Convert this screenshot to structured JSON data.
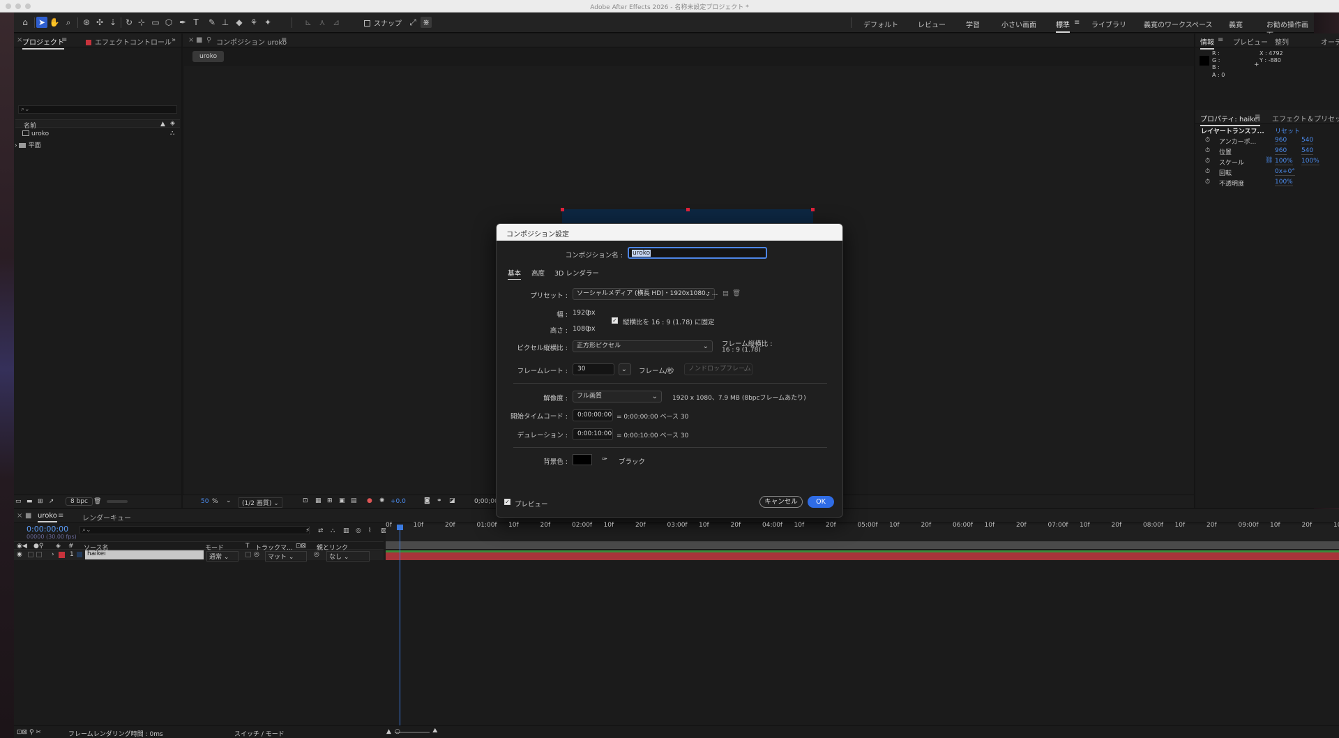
{
  "window": {
    "title": "Adobe After Effects 2026 - 名称未設定プロジェクト *"
  },
  "toolbar": {
    "snap_label": "スナップ"
  },
  "workspaces": [
    "デフォルト",
    "レビュー",
    "学習",
    "小さい画面",
    "標準",
    "ライブラリ",
    "義寛のワークスペース",
    "義寛",
    "お勧め操作画面"
  ],
  "project_panel": {
    "tab_project": "プロジェクト",
    "tab_effects": "エフェクトコントロール",
    "search_placeholder": "",
    "col_name": "名前",
    "items": [
      "uroko",
      "平面"
    ],
    "bpc": "8 bpc"
  },
  "comp_panel": {
    "tab": "コンポジション uroko",
    "breadcrumb": "uroko",
    "zoom_value": "50",
    "zoom_unit": "%",
    "resolution": "(1/2 画質)",
    "exposure": "+0.0",
    "timecode": "0;00;00;"
  },
  "info_panel": {
    "tabs": [
      "情報",
      "プレビュー",
      "整列",
      "オーデ"
    ],
    "r": "R :",
    "g": "G :",
    "b": "B :",
    "a": "A : 0",
    "x": "X : 4792",
    "y": "Y : -880"
  },
  "properties_panel": {
    "tabs": [
      "プロパティ: haikei",
      "エフェクト＆プリセット"
    ],
    "section": "レイヤートランスフ...",
    "reset": "リセット",
    "rows": [
      {
        "label": "アンカーポ...",
        "v1": "960",
        "v2": "540"
      },
      {
        "label": "位置",
        "v1": "960",
        "v2": "540"
      },
      {
        "label": "スケール",
        "v1": "100%",
        "v2": "100%"
      },
      {
        "label": "回転",
        "v1": "0x+0°",
        "v2": ""
      },
      {
        "label": "不透明度",
        "v1": "100%",
        "v2": ""
      }
    ]
  },
  "dialog": {
    "title": "コンポジション設定",
    "name_label": "コンポジション名 :",
    "name_value": "uroko",
    "tabs": [
      "基本",
      "高度",
      "3D レンダラー"
    ],
    "preset_label": "プリセット :",
    "preset_value": "ソーシャルメディア (横長 HD)・1920x1080・...",
    "width_label": "幅 :",
    "width_value": "1920",
    "px": "px",
    "height_label": "高さ :",
    "height_value": "1080",
    "lock_label": "縦横比を 16 : 9 (1.78) に固定",
    "par_label": "ピクセル縦横比 :",
    "par_value": "正方形ピクセル",
    "frame_aspect_label": "フレーム縦横比 :",
    "frame_aspect_value": "16 : 9 (1.78)",
    "fps_label": "フレームレート :",
    "fps_value": "30",
    "fps_unit": "フレーム/秒",
    "dropframe": "ノンドロップフレーム",
    "res_label": "解像度 :",
    "res_value": "フル画質",
    "res_info": "1920 x 1080、7.9 MB (8bpcフレームあたり)",
    "start_label": "開始タイムコード :",
    "start_value": "0:00:00:00",
    "start_info": "= 0:00:00:00  ベース 30",
    "dur_label": "デュレーション :",
    "dur_value": "0:00:10:00",
    "dur_info": "= 0:00:10:00  ベース 30",
    "bg_label": "背景色 :",
    "bg_name": "ブラック",
    "preview_label": "プレビュー",
    "cancel": "キャンセル",
    "ok": "OK"
  },
  "timeline": {
    "tab_comp": "uroko",
    "tab_render": "レンダーキュー",
    "timecode": "0:00:00:00",
    "fps_info": "00000 (30.00 fps)",
    "col_num": "#",
    "col_source": "ソース名",
    "col_mode": "モード",
    "col_t": "T",
    "col_track": "トラックマ...",
    "col_parent": "親とリンク",
    "layer": {
      "num": "1",
      "name": "haikei",
      "mode": "通常",
      "matte": "マット",
      "parent": "なし"
    },
    "ruler": [
      "0f",
      "10f",
      "20f",
      "01:00f",
      "10f",
      "20f",
      "02:00f",
      "10f",
      "20f",
      "03:00f",
      "10f",
      "20f",
      "04:00f",
      "10f",
      "20f",
      "05:00f",
      "10f",
      "20f",
      "06:00f",
      "10f",
      "20f",
      "07:00f",
      "10f",
      "20f",
      "08:00f",
      "10f",
      "20f",
      "09:00f",
      "10f",
      "20f",
      "10:0"
    ],
    "footer_render": "フレームレンダリング時間 : 0ms",
    "footer_switch": "スイッチ / モード"
  }
}
